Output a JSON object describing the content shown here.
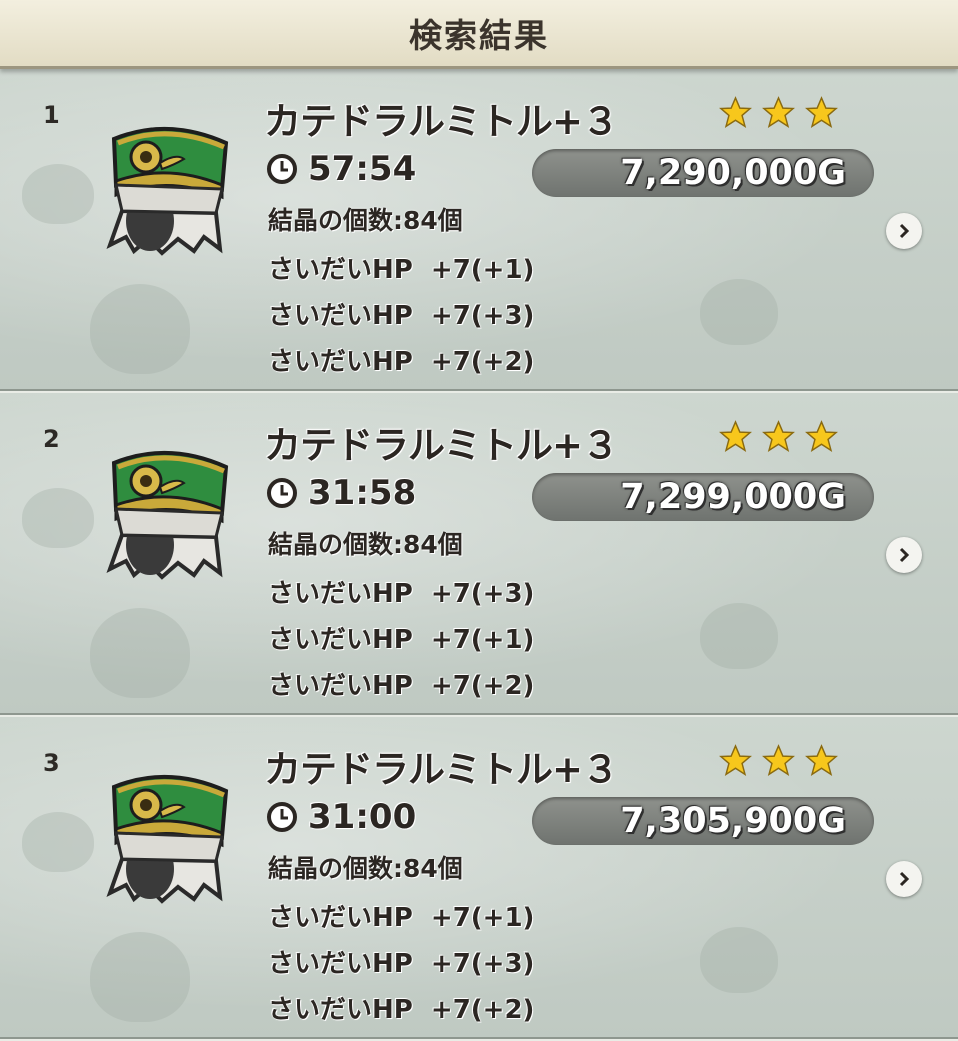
{
  "header": {
    "title": "検索結果"
  },
  "results": [
    {
      "rank": "1",
      "name": "カテドラルミトル+３",
      "stars": 3,
      "time": "57:54",
      "price": "7,290,000G",
      "crystal": "結晶の個数:84個",
      "stats": [
        "さいだいHP  +7(+1)",
        "さいだいHP  +7(+3)",
        "さいだいHP  +7(+2)"
      ]
    },
    {
      "rank": "2",
      "name": "カテドラルミトル+３",
      "stars": 3,
      "time": "31:58",
      "price": "7,299,000G",
      "crystal": "結晶の個数:84個",
      "stats": [
        "さいだいHP  +7(+3)",
        "さいだいHP  +7(+1)",
        "さいだいHP  +7(+2)"
      ]
    },
    {
      "rank": "3",
      "name": "カテドラルミトル+３",
      "stars": 3,
      "time": "31:00",
      "price": "7,305,900G",
      "crystal": "結晶の個数:84個",
      "stats": [
        "さいだいHP  +7(+1)",
        "さいだいHP  +7(+3)",
        "さいだいHP  +7(+2)"
      ]
    }
  ],
  "icons": {
    "item": "mitre-hat-icon",
    "clock": "clock-icon",
    "star": "star-icon",
    "arrow": "chevron-right-icon"
  },
  "colors": {
    "hat_green": "#2e8a3c",
    "star_gold": "#f5c41a",
    "price_pill": "#7a7e79"
  }
}
